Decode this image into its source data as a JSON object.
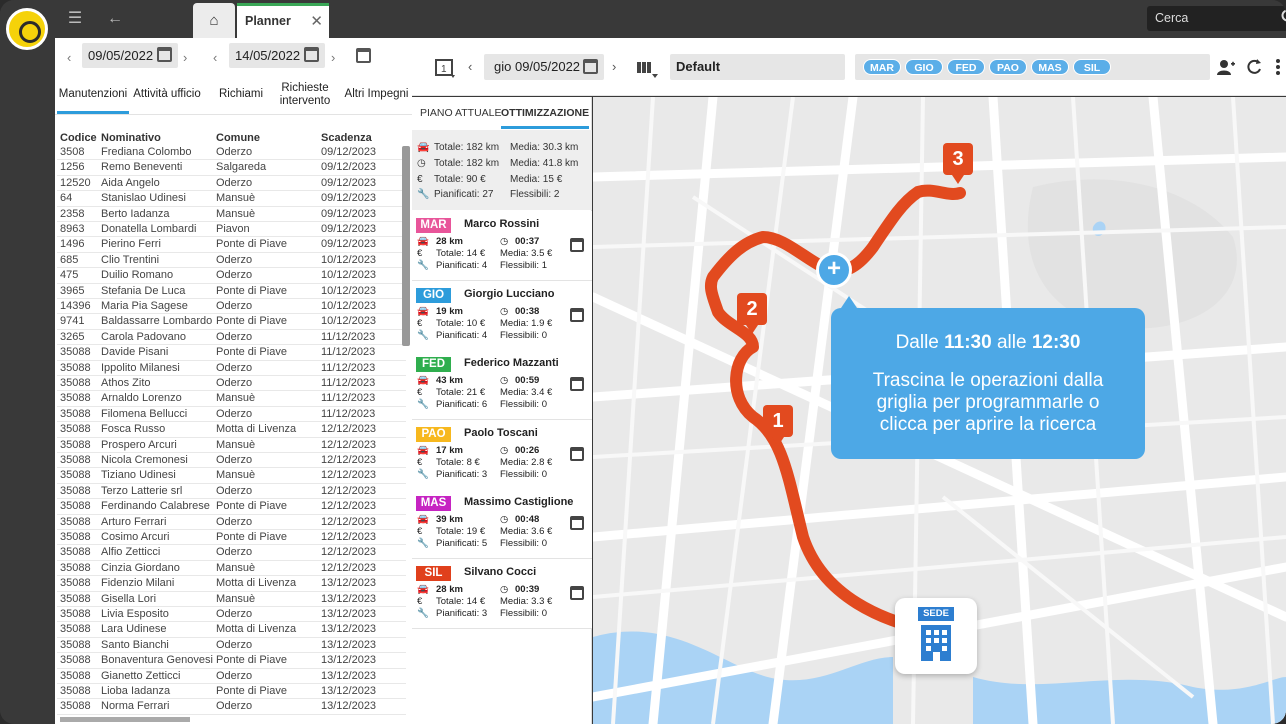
{
  "topbar": {
    "tab_label": "Planner",
    "close_glyph": "✕",
    "home_glyph": "⌂",
    "search_placeholder": "Cerca"
  },
  "left": {
    "date_from": "09/05/2022",
    "date_to": "14/05/2022",
    "tabs": [
      "Manutenzioni",
      "Attività ufficio",
      "Richiami",
      "Richieste intervento",
      "Altri Impegni"
    ],
    "active_tab": "Manutenzioni",
    "columns": [
      "Codice",
      "Nominativo",
      "Comune",
      "Scadenza"
    ],
    "rows": [
      [
        "3508",
        "Frediana Colombo",
        "Oderzo",
        "09/12/2023"
      ],
      [
        "1256",
        "Remo Beneventi",
        "Salgareda",
        "09/12/2023"
      ],
      [
        "12520",
        "Aida Angelo",
        "Oderzo",
        "09/12/2023"
      ],
      [
        "64",
        "Stanislao Udinesi",
        "Mansuè",
        "09/12/2023"
      ],
      [
        "2358",
        "Berto Iadanza",
        "Mansuè",
        "09/12/2023"
      ],
      [
        "8963",
        "Donatella Lombardi",
        "Piavon",
        "09/12/2023"
      ],
      [
        "1496",
        "Pierino Ferri",
        "Ponte di Piave",
        "09/12/2023"
      ],
      [
        "685",
        "Clio Trentini",
        "Oderzo",
        "10/12/2023"
      ],
      [
        "475",
        "Duilio Romano",
        "Oderzo",
        "10/12/2023"
      ],
      [
        "3965",
        "Stefania De Luca",
        "Ponte di Piave",
        "10/12/2023"
      ],
      [
        "14396",
        "Maria Pia Sagese",
        "Oderzo",
        "10/12/2023"
      ],
      [
        "9741",
        "Baldassarre Lombardo",
        "Ponte di Piave",
        "10/12/2023"
      ],
      [
        "3265",
        "Carola Padovano",
        "Oderzo",
        "11/12/2023"
      ],
      [
        "35088",
        "Davide Pisani",
        "Ponte di Piave",
        "11/12/2023"
      ],
      [
        "35088",
        "Ippolito Milanesi",
        "Oderzo",
        "11/12/2023"
      ],
      [
        "35088",
        "Athos Zito",
        "Oderzo",
        "11/12/2023"
      ],
      [
        "35088",
        "Arnaldo Lorenzo",
        "Mansuè",
        "11/12/2023"
      ],
      [
        "35088",
        "Filomena Bellucci",
        "Oderzo",
        "11/12/2023"
      ],
      [
        "35088",
        "Fosca Russo",
        "Motta di Livenza",
        "12/12/2023"
      ],
      [
        "35088",
        "Prospero Arcuri",
        "Mansuè",
        "12/12/2023"
      ],
      [
        "35088",
        "Nicola Cremonesi",
        "Oderzo",
        "12/12/2023"
      ],
      [
        "35088",
        "Tiziano Udinesi",
        "Mansuè",
        "12/12/2023"
      ],
      [
        "35088",
        "Terzo Latterie srl",
        "Oderzo",
        "12/12/2023"
      ],
      [
        "35088",
        "Ferdinando Calabrese",
        "Ponte di Piave",
        "12/12/2023"
      ],
      [
        "35088",
        "Arturo Ferrari",
        "Oderzo",
        "12/12/2023"
      ],
      [
        "35088",
        "Cosimo Arcuri",
        "Ponte di Piave",
        "12/12/2023"
      ],
      [
        "35088",
        "Alfio Zetticci",
        "Oderzo",
        "12/12/2023"
      ],
      [
        "35088",
        "Cinzia Giordano",
        "Mansuè",
        "12/12/2023"
      ],
      [
        "35088",
        "Fidenzio Milani",
        "Motta di Livenza",
        "13/12/2023"
      ],
      [
        "35088",
        "Gisella Lori",
        "Mansuè",
        "13/12/2023"
      ],
      [
        "35088",
        "Livia Esposito",
        "Oderzo",
        "13/12/2023"
      ],
      [
        "35088",
        "Lara Udinese",
        "Motta di Livenza",
        "13/12/2023"
      ],
      [
        "35088",
        "Santo Bianchi",
        "Oderzo",
        "13/12/2023"
      ],
      [
        "35088",
        "Bonaventura Genovesi",
        "Ponte di Piave",
        "13/12/2023"
      ],
      [
        "35088",
        "Gianetto Zetticci",
        "Oderzo",
        "13/12/2023"
      ],
      [
        "35088",
        "Lioba Iadanza",
        "Ponte di Piave",
        "13/12/2023"
      ],
      [
        "35088",
        "Norma Ferrari",
        "Oderzo",
        "13/12/2023"
      ]
    ]
  },
  "toolbar": {
    "date": "gio 09/05/2022",
    "view": "Default",
    "pills": [
      "MAR",
      "GIO",
      "FED",
      "PAO",
      "MAS",
      "SIL"
    ]
  },
  "mid": {
    "tab_current": "PIANO ATTUALE",
    "tab_opt": "OTTIMIZZAZIONE",
    "summary": {
      "km_total": "Totale: 182 km",
      "km_avg": "Media: 30.3 km",
      "time_total": "Totale: 182 km",
      "time_avg": "Media: 41.8 km",
      "cost_total": "Totale: 90 €",
      "cost_avg": "Media: 15 €",
      "planned": "Pianificati: 27",
      "flexible": "Flessibili: 2"
    },
    "cards": [
      {
        "code": "MAR",
        "color": "#e8559a",
        "name": "Marco Rossini",
        "km": "28 km",
        "time": "00:37",
        "tot": "Totale: 14 €",
        "avg": "Media: 3.5 €",
        "plan": "Pianificati: 4",
        "flex": "Flessibili: 1"
      },
      {
        "code": "GIO",
        "color": "#2d9cdb",
        "name": "Giorgio Lucciano",
        "km": "19 km",
        "time": "00:38",
        "tot": "Totale: 10 €",
        "avg": "Media: 1.9 €",
        "plan": "Pianificati: 4",
        "flex": "Flessibili: 0"
      },
      {
        "code": "FED",
        "color": "#2fae4e",
        "name": "Federico Mazzanti",
        "km": "43 km",
        "time": "00:59",
        "tot": "Totale: 21 €",
        "avg": "Media: 3.4 €",
        "plan": "Pianificati: 6",
        "flex": "Flessibili: 0"
      },
      {
        "code": "PAO",
        "color": "#f7b81e",
        "name": "Paolo Toscani",
        "km": "17 km",
        "time": "00:26",
        "tot": "Totale: 8 €",
        "avg": "Media: 2.8 €",
        "plan": "Pianificati: 3",
        "flex": "Flessibili: 0"
      },
      {
        "code": "MAS",
        "color": "#c624c2",
        "name": "Massimo Castiglione",
        "km": "39 km",
        "time": "00:48",
        "tot": "Totale: 19 €",
        "avg": "Media: 3.6 €",
        "plan": "Pianificati: 5",
        "flex": "Flessibili: 0"
      },
      {
        "code": "SIL",
        "color": "#e0401c",
        "name": "Silvano Cocci",
        "km": "28 km",
        "time": "00:39",
        "tot": "Totale: 14 €",
        "avg": "Media: 3.3 €",
        "plan": "Pianificati: 3",
        "flex": "Flessibili: 0"
      }
    ]
  },
  "map": {
    "tip_prefix": "Dalle ",
    "tip_from": "11:30",
    "tip_mid": " alle ",
    "tip_to": "12:30",
    "tip_message": "Trascina le operazioni dalla griglia per programmarle o clicca per aprire la ricerca",
    "sede_label": "SEDE",
    "markers": [
      "1",
      "2",
      "3"
    ],
    "plus_glyph": "+",
    "route_color": "#e24a1f"
  }
}
